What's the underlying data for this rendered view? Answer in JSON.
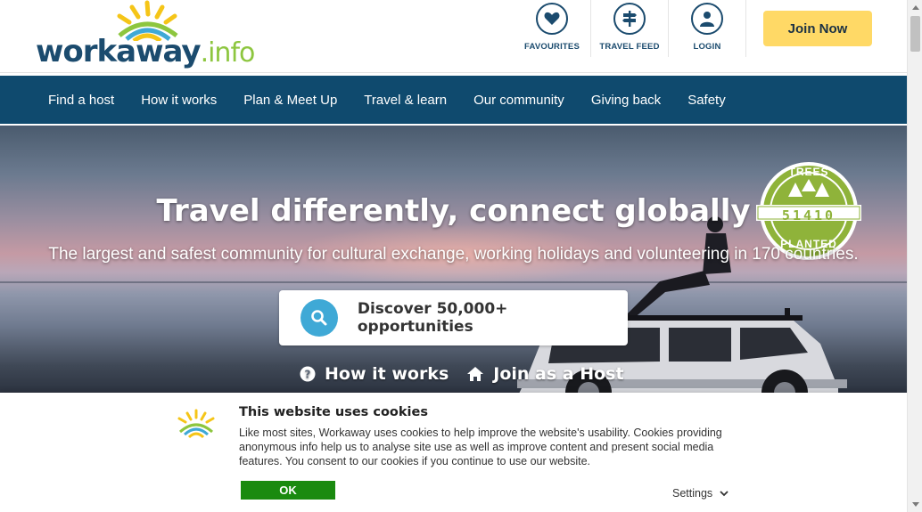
{
  "header": {
    "logo": {
      "main": "workaway",
      "suffix": ".info"
    },
    "icons": [
      {
        "name": "favourites",
        "label": "FAVOURITES",
        "icon": "heart-icon"
      },
      {
        "name": "travel-feed",
        "label": "TRAVEL FEED",
        "icon": "signpost-icon"
      },
      {
        "name": "login",
        "label": "LOGIN",
        "icon": "user-icon"
      }
    ],
    "join_label": "Join Now"
  },
  "nav": {
    "items": [
      {
        "label": "Find a host"
      },
      {
        "label": "How it works"
      },
      {
        "label": "Plan & Meet Up"
      },
      {
        "label": "Travel & learn"
      },
      {
        "label": "Our community"
      },
      {
        "label": "Giving back"
      },
      {
        "label": "Safety"
      }
    ]
  },
  "hero": {
    "title": "Travel differently, connect globally",
    "subtitle": "The largest and safest community for cultural exchange, working holidays and volunteering in 170 countries.",
    "discover_label": "Discover 50,000+ opportunities",
    "links": [
      {
        "label": "How it works",
        "icon": "question-circle-icon"
      },
      {
        "label": "Join as a Host",
        "icon": "home-icon"
      }
    ],
    "trees_badge": {
      "top": "TREES",
      "count": "51410",
      "bottom": "PLANTED"
    }
  },
  "cookie": {
    "title": "This website uses cookies",
    "text": "Like most sites, Workaway uses cookies to help improve the website's usability. Cookies providing anonymous info help us to analyse site use as well as improve content and present social media features.  You consent to our cookies if you continue to use our website.",
    "ok_label": "OK",
    "settings_label": "Settings"
  },
  "colors": {
    "brand_blue": "#1b4b6e",
    "nav_bg": "#0f4a6e",
    "brand_green": "#8dc63f",
    "join_yellow": "#ffd966",
    "ok_green": "#1a8a0f",
    "search_blue": "#3fa9d6",
    "trees_green": "#8fb33a"
  }
}
